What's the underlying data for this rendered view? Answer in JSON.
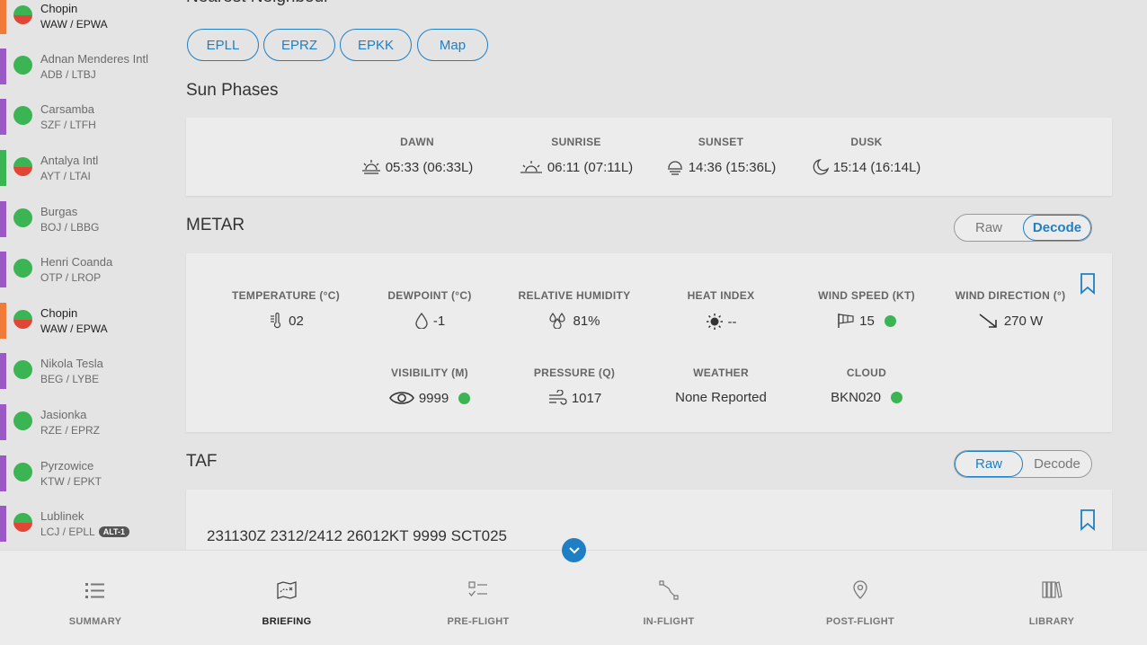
{
  "sidebar": {
    "items": [
      {
        "name": "Chopin",
        "code": "WAW / EPWA",
        "bar_color": "#f07a3a",
        "status": "green-red",
        "active": true,
        "badge": ""
      },
      {
        "name": "Adnan Menderes Intl",
        "code": "ADB / LTBJ",
        "bar_color": "#9b59c5",
        "status": "green-green",
        "active": false,
        "badge": ""
      },
      {
        "name": "Carsamba",
        "code": "SZF / LTFH",
        "bar_color": "#9b59c5",
        "status": "green-green",
        "active": false,
        "badge": ""
      },
      {
        "name": "Antalya Intl",
        "code": "AYT / LTAI",
        "bar_color": "#3bb554",
        "status": "green-red",
        "active": false,
        "badge": ""
      },
      {
        "name": "Burgas",
        "code": "BOJ / LBBG",
        "bar_color": "#9b59c5",
        "status": "green-green",
        "active": false,
        "badge": ""
      },
      {
        "name": "Henri Coanda",
        "code": "OTP / LROP",
        "bar_color": "#9b59c5",
        "status": "green-green",
        "active": false,
        "badge": ""
      },
      {
        "name": "Chopin",
        "code": "WAW / EPWA",
        "bar_color": "#f07a3a",
        "status": "green-red",
        "active": true,
        "badge": ""
      },
      {
        "name": "Nikola Tesla",
        "code": "BEG / LYBE",
        "bar_color": "#9b59c5",
        "status": "green-green",
        "active": false,
        "badge": ""
      },
      {
        "name": "Jasionka",
        "code": "RZE / EPRZ",
        "bar_color": "#9b59c5",
        "status": "green-green",
        "active": false,
        "badge": ""
      },
      {
        "name": "Pyrzowice",
        "code": "KTW / EPKT",
        "bar_color": "#9b59c5",
        "status": "green-green",
        "active": false,
        "badge": ""
      },
      {
        "name": "Lublinek",
        "code": "LCJ / EPLL",
        "bar_color": "#9b59c5",
        "status": "green-red",
        "active": false,
        "badge": "ALT-1"
      }
    ]
  },
  "nearest": {
    "title": "Nearest Neighbour",
    "buttons": [
      "EPLL",
      "EPRZ",
      "EPKK",
      "Map"
    ]
  },
  "sun": {
    "title": "Sun Phases",
    "items": [
      {
        "label": "DAWN",
        "value": "05:33 (06:33L)",
        "icon": "dawn-icon"
      },
      {
        "label": "SUNRISE",
        "value": "06:11 (07:11L)",
        "icon": "sunrise-icon"
      },
      {
        "label": "SUNSET",
        "value": "14:36 (15:36L)",
        "icon": "sunset-icon"
      },
      {
        "label": "DUSK",
        "value": "15:14 (16:14L)",
        "icon": "moon-icon"
      }
    ]
  },
  "metar": {
    "title": "METAR",
    "toggle": {
      "raw": "Raw",
      "decode": "Decode",
      "selected": "Decode"
    },
    "items": [
      {
        "label": "TEMPERATURE (°C)",
        "value": "02",
        "icon": "thermometer-icon",
        "dot": false
      },
      {
        "label": "DEWPOINT (°C)",
        "value": "-1",
        "icon": "droplet-icon",
        "dot": false
      },
      {
        "label": "RELATIVE HUMIDITY",
        "value": "81%",
        "icon": "humidity-icon",
        "dot": false
      },
      {
        "label": "HEAT INDEX",
        "value": "--",
        "icon": "sun-icon",
        "dot": false
      },
      {
        "label": "WIND SPEED (KT)",
        "value": "15",
        "icon": "windsock-icon",
        "dot": true
      },
      {
        "label": "WIND DIRECTION (°)",
        "value": "270 W",
        "icon": "arrow-icon",
        "dot": false
      },
      {
        "label": "VISIBILITY (M)",
        "value": "9999",
        "icon": "eye-icon",
        "dot": true
      },
      {
        "label": "PRESSURE (Q)",
        "value": "1017",
        "icon": "wind-icon",
        "dot": false
      },
      {
        "label": "WEATHER",
        "value": "None Reported",
        "icon": "",
        "dot": false
      },
      {
        "label": "CLOUD",
        "value": "BKN020",
        "icon": "",
        "dot": true
      }
    ]
  },
  "taf": {
    "title": "TAF",
    "toggle": {
      "raw": "Raw",
      "decode": "Decode",
      "selected": "Raw"
    },
    "text": "231130Z 2312/2412 26012KT 9999 SCT025"
  },
  "colors": {
    "accent": "#1f7fc4",
    "status_green": "#3bb554",
    "status_red": "#e04535"
  },
  "bottomnav": {
    "items": [
      {
        "label": "SUMMARY",
        "icon": "list-icon",
        "active": false
      },
      {
        "label": "BRIEFING",
        "icon": "map-icon",
        "active": true
      },
      {
        "label": "PRE-FLIGHT",
        "icon": "checklist-icon",
        "active": false
      },
      {
        "label": "IN-FLIGHT",
        "icon": "route-icon",
        "active": false
      },
      {
        "label": "POST-FLIGHT",
        "icon": "location-pin-icon",
        "active": false
      },
      {
        "label": "LIBRARY",
        "icon": "library-icon",
        "active": false
      }
    ]
  }
}
